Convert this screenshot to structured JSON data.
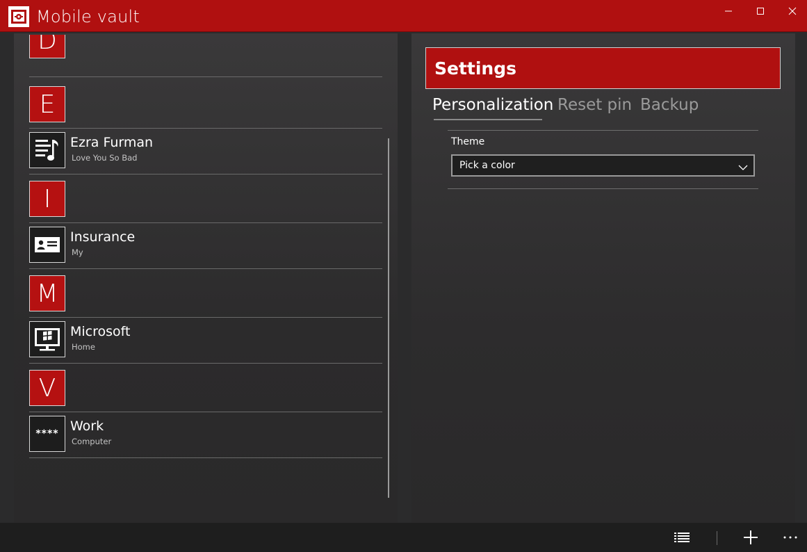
{
  "window": {
    "title": "Mobile vault",
    "colors": {
      "accent": "#b01010",
      "background": "#2b2b2c",
      "appbar": "#1e1e1e"
    }
  },
  "list": {
    "groups": [
      {
        "letter": "D"
      },
      {
        "letter": "E"
      },
      {
        "letter": "I"
      },
      {
        "letter": "M"
      },
      {
        "letter": "V"
      }
    ],
    "items": [
      {
        "title": "Ezra Furman",
        "subtitle": "Love You So Bad",
        "icon": "music-list-icon"
      },
      {
        "title": "Insurance",
        "subtitle": "My",
        "icon": "id-card-icon"
      },
      {
        "title": "Microsoft",
        "subtitle": "Home",
        "icon": "computer-monitor-icon"
      },
      {
        "title": "Work",
        "subtitle": "Computer",
        "icon": "password-icon",
        "icon_text": "****"
      }
    ]
  },
  "settings": {
    "title": "Settings",
    "tabs": [
      {
        "label": "Personalization",
        "active": true
      },
      {
        "label": "Reset pin",
        "active": false
      },
      {
        "label": "Backup",
        "active": false
      }
    ],
    "theme": {
      "label": "Theme",
      "value": "Pick a color"
    }
  },
  "appbar": {
    "icons": [
      "list-view-icon",
      "add-icon",
      "more-icon"
    ]
  }
}
